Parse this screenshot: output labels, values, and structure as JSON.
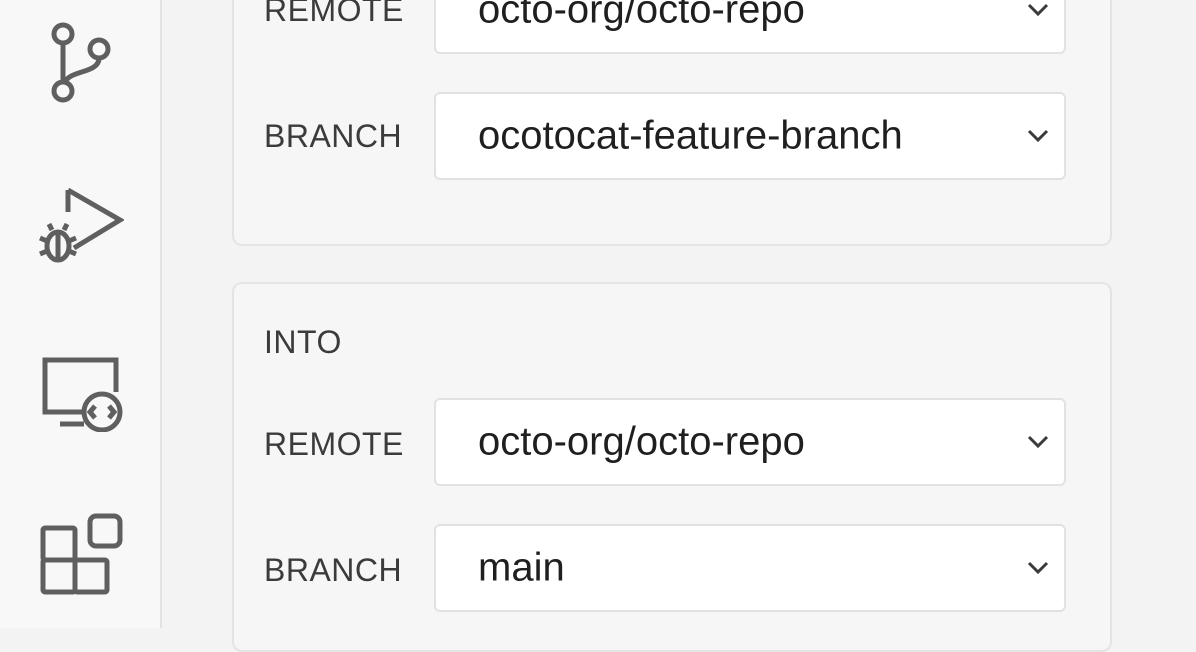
{
  "activity_bar": {
    "icons": [
      "source-control-icon",
      "run-and-debug-icon",
      "remote-explorer-icon",
      "extensions-icon"
    ]
  },
  "merge_from": {
    "remote_label": "REMOTE",
    "remote_value": "octo-org/octo-repo",
    "branch_label": "BRANCH",
    "branch_value": "ocotocat-feature-branch"
  },
  "merge_into": {
    "title": "INTO",
    "remote_label": "REMOTE",
    "remote_value": "octo-org/octo-repo",
    "branch_label": "BRANCH",
    "branch_value": "main"
  },
  "colors": {
    "panel_bg": "#f3f3f3",
    "group_bg": "#f6f6f6",
    "border": "#e2e2e2",
    "text": "#3b3b3b",
    "icon": "#5f5f5f"
  }
}
